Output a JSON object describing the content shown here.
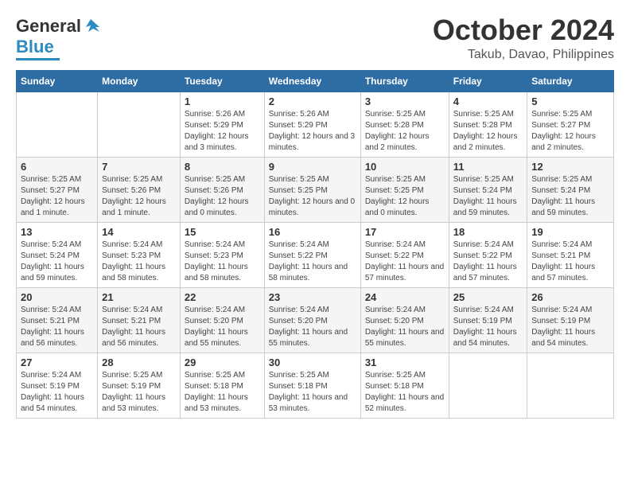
{
  "header": {
    "logo_general": "General",
    "logo_blue": "Blue",
    "month_title": "October 2024",
    "location": "Takub, Davao, Philippines"
  },
  "days_of_week": [
    "Sunday",
    "Monday",
    "Tuesday",
    "Wednesday",
    "Thursday",
    "Friday",
    "Saturday"
  ],
  "weeks": [
    [
      {
        "day": "",
        "info": ""
      },
      {
        "day": "",
        "info": ""
      },
      {
        "day": "1",
        "info": "Sunrise: 5:26 AM\nSunset: 5:29 PM\nDaylight: 12 hours and 3 minutes."
      },
      {
        "day": "2",
        "info": "Sunrise: 5:26 AM\nSunset: 5:29 PM\nDaylight: 12 hours and 3 minutes."
      },
      {
        "day": "3",
        "info": "Sunrise: 5:25 AM\nSunset: 5:28 PM\nDaylight: 12 hours and 2 minutes."
      },
      {
        "day": "4",
        "info": "Sunrise: 5:25 AM\nSunset: 5:28 PM\nDaylight: 12 hours and 2 minutes."
      },
      {
        "day": "5",
        "info": "Sunrise: 5:25 AM\nSunset: 5:27 PM\nDaylight: 12 hours and 2 minutes."
      }
    ],
    [
      {
        "day": "6",
        "info": "Sunrise: 5:25 AM\nSunset: 5:27 PM\nDaylight: 12 hours and 1 minute."
      },
      {
        "day": "7",
        "info": "Sunrise: 5:25 AM\nSunset: 5:26 PM\nDaylight: 12 hours and 1 minute."
      },
      {
        "day": "8",
        "info": "Sunrise: 5:25 AM\nSunset: 5:26 PM\nDaylight: 12 hours and 0 minutes."
      },
      {
        "day": "9",
        "info": "Sunrise: 5:25 AM\nSunset: 5:25 PM\nDaylight: 12 hours and 0 minutes."
      },
      {
        "day": "10",
        "info": "Sunrise: 5:25 AM\nSunset: 5:25 PM\nDaylight: 12 hours and 0 minutes."
      },
      {
        "day": "11",
        "info": "Sunrise: 5:25 AM\nSunset: 5:24 PM\nDaylight: 11 hours and 59 minutes."
      },
      {
        "day": "12",
        "info": "Sunrise: 5:25 AM\nSunset: 5:24 PM\nDaylight: 11 hours and 59 minutes."
      }
    ],
    [
      {
        "day": "13",
        "info": "Sunrise: 5:24 AM\nSunset: 5:24 PM\nDaylight: 11 hours and 59 minutes."
      },
      {
        "day": "14",
        "info": "Sunrise: 5:24 AM\nSunset: 5:23 PM\nDaylight: 11 hours and 58 minutes."
      },
      {
        "day": "15",
        "info": "Sunrise: 5:24 AM\nSunset: 5:23 PM\nDaylight: 11 hours and 58 minutes."
      },
      {
        "day": "16",
        "info": "Sunrise: 5:24 AM\nSunset: 5:22 PM\nDaylight: 11 hours and 58 minutes."
      },
      {
        "day": "17",
        "info": "Sunrise: 5:24 AM\nSunset: 5:22 PM\nDaylight: 11 hours and 57 minutes."
      },
      {
        "day": "18",
        "info": "Sunrise: 5:24 AM\nSunset: 5:22 PM\nDaylight: 11 hours and 57 minutes."
      },
      {
        "day": "19",
        "info": "Sunrise: 5:24 AM\nSunset: 5:21 PM\nDaylight: 11 hours and 57 minutes."
      }
    ],
    [
      {
        "day": "20",
        "info": "Sunrise: 5:24 AM\nSunset: 5:21 PM\nDaylight: 11 hours and 56 minutes."
      },
      {
        "day": "21",
        "info": "Sunrise: 5:24 AM\nSunset: 5:21 PM\nDaylight: 11 hours and 56 minutes."
      },
      {
        "day": "22",
        "info": "Sunrise: 5:24 AM\nSunset: 5:20 PM\nDaylight: 11 hours and 55 minutes."
      },
      {
        "day": "23",
        "info": "Sunrise: 5:24 AM\nSunset: 5:20 PM\nDaylight: 11 hours and 55 minutes."
      },
      {
        "day": "24",
        "info": "Sunrise: 5:24 AM\nSunset: 5:20 PM\nDaylight: 11 hours and 55 minutes."
      },
      {
        "day": "25",
        "info": "Sunrise: 5:24 AM\nSunset: 5:19 PM\nDaylight: 11 hours and 54 minutes."
      },
      {
        "day": "26",
        "info": "Sunrise: 5:24 AM\nSunset: 5:19 PM\nDaylight: 11 hours and 54 minutes."
      }
    ],
    [
      {
        "day": "27",
        "info": "Sunrise: 5:24 AM\nSunset: 5:19 PM\nDaylight: 11 hours and 54 minutes."
      },
      {
        "day": "28",
        "info": "Sunrise: 5:25 AM\nSunset: 5:19 PM\nDaylight: 11 hours and 53 minutes."
      },
      {
        "day": "29",
        "info": "Sunrise: 5:25 AM\nSunset: 5:18 PM\nDaylight: 11 hours and 53 minutes."
      },
      {
        "day": "30",
        "info": "Sunrise: 5:25 AM\nSunset: 5:18 PM\nDaylight: 11 hours and 53 minutes."
      },
      {
        "day": "31",
        "info": "Sunrise: 5:25 AM\nSunset: 5:18 PM\nDaylight: 11 hours and 52 minutes."
      },
      {
        "day": "",
        "info": ""
      },
      {
        "day": "",
        "info": ""
      }
    ]
  ]
}
